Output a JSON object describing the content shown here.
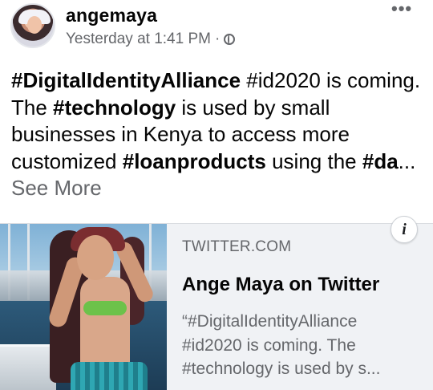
{
  "post": {
    "author": "angemaya",
    "timestamp": "Yesterday at 1:41 PM",
    "separator": "·",
    "privacy_icon": "globe-icon",
    "more_icon": "more-options-icon",
    "text_segments": [
      {
        "text": "#DigitalIdentityAlliance",
        "bold": true
      },
      {
        "text": " #id2020 is coming. The ",
        "bold": false
      },
      {
        "text": "#technology",
        "bold": true
      },
      {
        "text": " is used by small businesses in Kenya to access more customized ",
        "bold": false
      },
      {
        "text": "#loanproducts",
        "bold": true
      },
      {
        "text": " using the ",
        "bold": false
      },
      {
        "text": "#da",
        "bold": true
      },
      {
        "text": "...",
        "bold": false
      }
    ],
    "see_more": "See More"
  },
  "link_card": {
    "domain": "TWITTER.COM",
    "title": "Ange Maya on Twitter",
    "description": "“#DigitalIdentityAlliance #id2020 is coming. The #technology is used by s...",
    "info_label": "i"
  },
  "colors": {
    "text_primary": "#050505",
    "text_secondary": "#65676b",
    "card_background": "#f0f2f5"
  }
}
